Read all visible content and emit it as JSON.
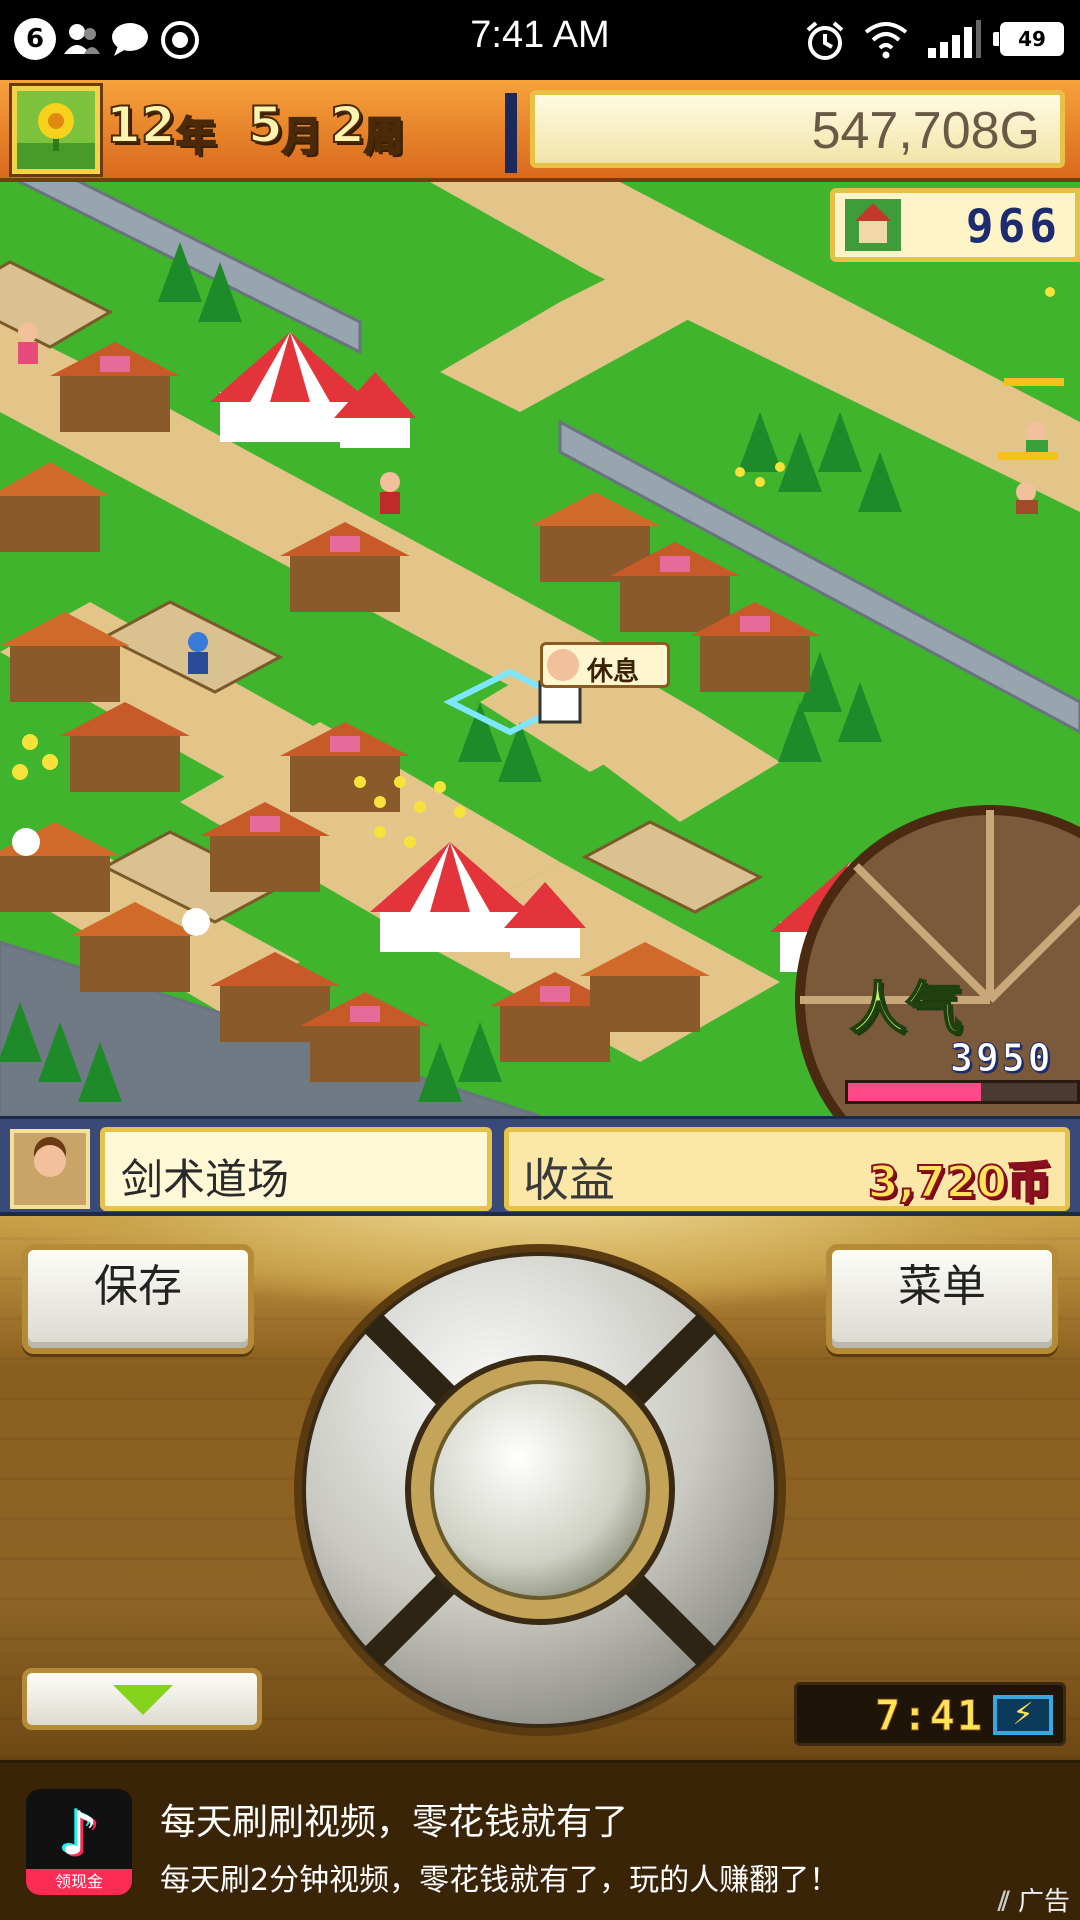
{
  "status_bar": {
    "notification_count": "6",
    "time": "7:41 AM",
    "battery": "49",
    "icons": [
      "people-icon",
      "chat-icon",
      "record-icon",
      "alarm-icon",
      "wifi-icon",
      "signal-icon"
    ]
  },
  "hud": {
    "year_num": "12",
    "year_unit": "年",
    "month_num": "5",
    "month_unit": "月",
    "week_num": "2",
    "week_unit": "周",
    "money": "547,708G",
    "town_count": "966"
  },
  "map": {
    "popup_label": "休息",
    "popularity_label": "人气",
    "popularity_value": "3950",
    "popularity_level": 0.58
  },
  "info_bar": {
    "facility_name": "剑术道场",
    "income_label": "收益",
    "income_value": "3,720币"
  },
  "controls": {
    "save_label": "保存",
    "menu_label": "菜单",
    "clock": "7:41",
    "battery_symbol": "⚡"
  },
  "ad": {
    "logo_tag": "领现金",
    "title": "每天刷刷视频，零花钱就有了",
    "subtitle": "每天刷2分钟视频，零花钱就有了，玩的人赚翻了！",
    "label": "广告"
  },
  "colors": {
    "grass": "#3fb42c",
    "path": "#e6c98a",
    "wall": "#8e9aa4",
    "roof_red": "#c83a2a",
    "hud_orange": "#f2902e",
    "info_blue": "#3a4a78",
    "income_red": "#8a1020"
  }
}
